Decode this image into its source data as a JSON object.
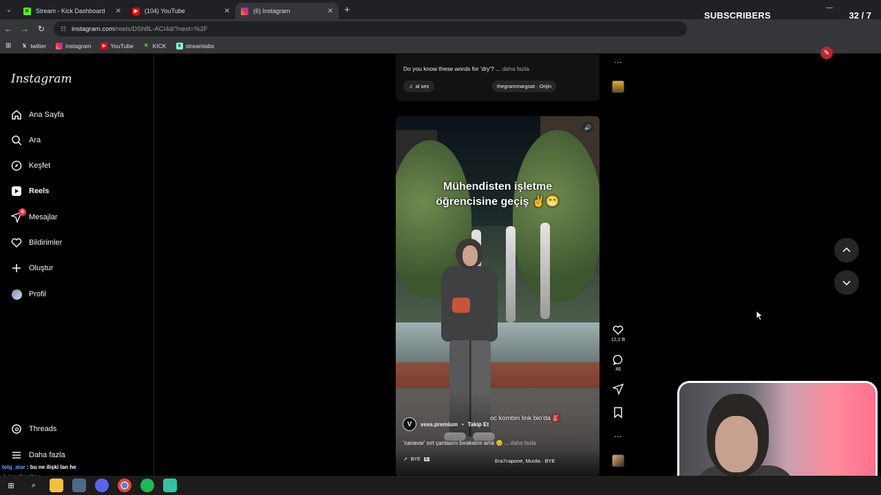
{
  "browser": {
    "tabs": [
      {
        "label": "Stream - Kick Dashboard",
        "icon": "kick-icon",
        "color": "#53fc18",
        "active": false
      },
      {
        "label": "(104) YouTube",
        "icon": "youtube-icon",
        "color": "#ff0000",
        "active": false
      },
      {
        "label": "(6) Instagram",
        "icon": "instagram-icon",
        "color": "#e1306c",
        "active": true
      }
    ],
    "url_host": "instagram.com",
    "url_rest": "/reels/DSh8L-ACI4d/?next=%2F",
    "bookmarks": [
      "twitter",
      "instagram",
      "YouTube",
      "KICK",
      "streamlabs"
    ]
  },
  "subscribers": {
    "label": "SUBSCRIBERS",
    "count": "32  / 7",
    "progress": 1.0
  },
  "sidebar": {
    "logo": "Instagram",
    "items": [
      {
        "label": "Ana Sayfa",
        "icon": "home-icon"
      },
      {
        "label": "Ara",
        "icon": "search-icon"
      },
      {
        "label": "Keşfet",
        "icon": "explore-icon"
      },
      {
        "label": "Reels",
        "icon": "reels-icon",
        "active": true
      },
      {
        "label": "Mesajlar",
        "icon": "messages-icon",
        "badge": "6"
      },
      {
        "label": "Bildirimler",
        "icon": "heart-icon"
      },
      {
        "label": "Oluştur",
        "icon": "plus-icon"
      },
      {
        "label": "Profil",
        "icon": "avatar"
      },
      {
        "label": "Threads",
        "icon": "threads-icon"
      },
      {
        "label": "Daha fazla",
        "icon": "menu-icon"
      }
    ]
  },
  "chat": [
    {
      "user": "tolg_atar",
      "message": "bu ne ilişki lan he"
    },
    {
      "user": "jogaburrito",
      "message": ""
    }
  ],
  "previous_reel": {
    "caption": "Do you know these words for 'dry'? ...",
    "more": "daha fazla",
    "audio": "al ses",
    "track": "thegrammargoat · Orijin"
  },
  "reel": {
    "title_line1": "Mühendisten işletme",
    "title_line2": "öğrencisine geçiş ✌😁",
    "sticker": "oc kombin link bio'da 🎒",
    "author": "vess.premium",
    "separator": "•",
    "follow": "Takip Et",
    "caption": "'canavar' sırt çantasını bırakalım artık 😊 ...",
    "more": "daha fazla",
    "audio_label": "BYE",
    "track": "Era7capone, Murda · BYE",
    "likes": "12,2 B",
    "comments": "48"
  }
}
